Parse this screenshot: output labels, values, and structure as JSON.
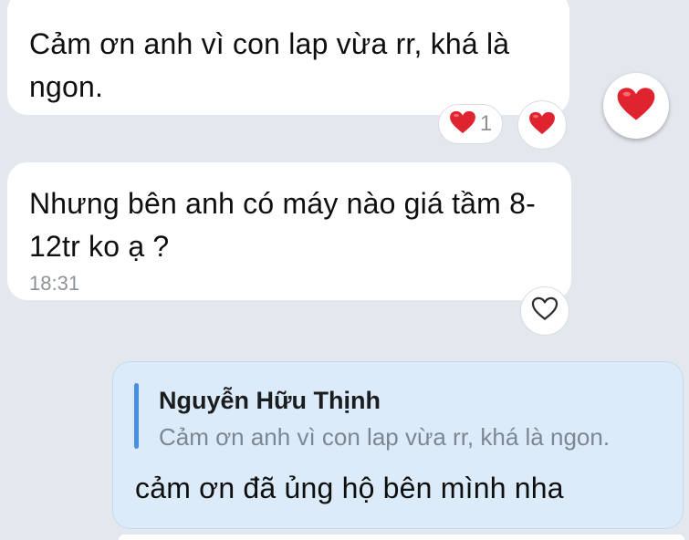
{
  "messages": {
    "incoming_1": {
      "text": "Cảm ơn anh vì con lap vừa rr, khá là ngon.",
      "reactions": {
        "icon": "heart-icon",
        "count": "1"
      }
    },
    "incoming_2": {
      "text": "Nhưng bên anh có máy nào giá tầm 8-12tr ko ạ ?",
      "time": "18:31"
    },
    "outgoing_reply": {
      "quote_author": "Nguyễn Hữu Thịnh",
      "quote_text": "Cảm ơn anh vì con lap vừa rr, khá là ngon.",
      "text": "cảm ơn đã ủng hộ bên mình nha"
    }
  },
  "colors": {
    "background": "#e3e7ee",
    "incoming_bubble": "#ffffff",
    "outgoing_bubble": "#dcebf9",
    "quote_bar": "#4a8ee0",
    "heart": "#e0242f",
    "muted_text": "#8d9298"
  },
  "icons": {
    "reaction_heart": "heart-icon",
    "like_outline": "heart-outline-icon"
  }
}
